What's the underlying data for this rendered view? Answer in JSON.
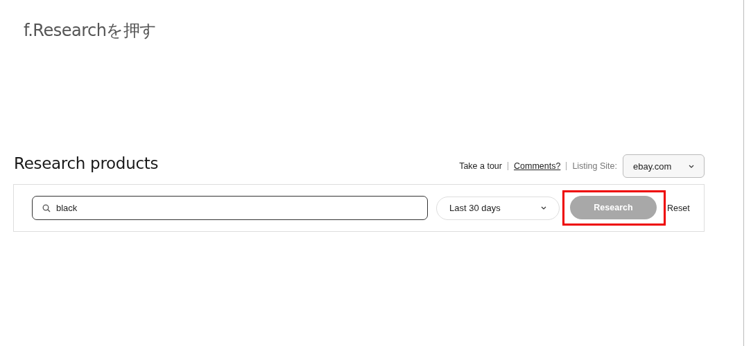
{
  "caption": "f.Researchを押す",
  "page": {
    "title": "Research products",
    "links": [
      {
        "label": "Take a tour",
        "kind": "plain"
      },
      {
        "label": "Comments?",
        "kind": "underlined"
      }
    ],
    "listing_site": {
      "label": "Listing Site:",
      "value": "ebay.com"
    }
  },
  "search": {
    "value": "black"
  },
  "date_range": {
    "value": "Last 30 days"
  },
  "research_button": {
    "label": "Research",
    "disabled": true,
    "highlighted": true
  },
  "reset_link": {
    "label": "Reset"
  }
}
